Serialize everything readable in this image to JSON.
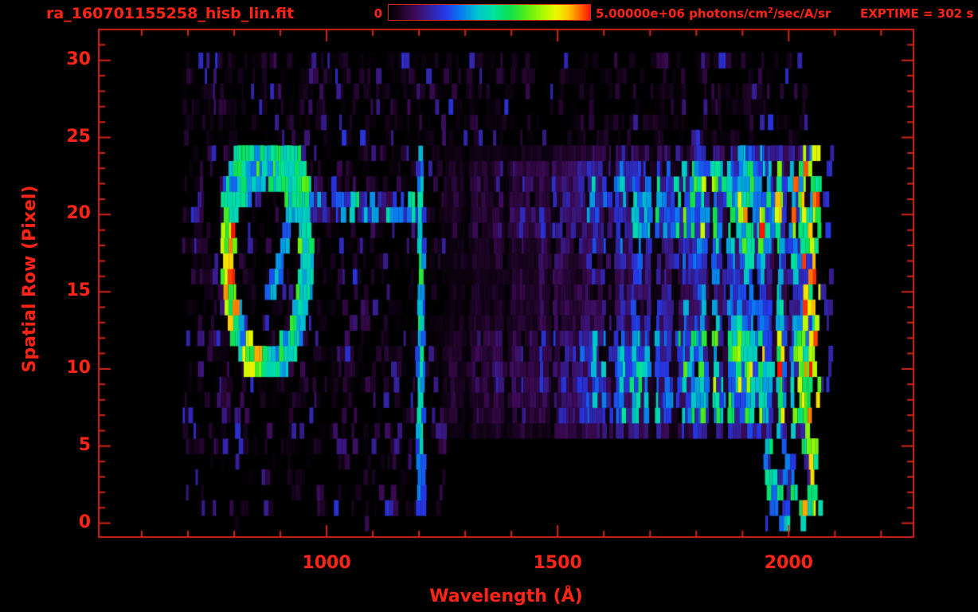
{
  "header": {
    "title": "ra_160701155258_hisb_lin.fit",
    "colorbar_min": "0",
    "colorbar_max": "5.00000e+06",
    "units_prefix": " photons/cm",
    "units_sup": "2",
    "units_suffix": "/sec/A/sr",
    "exptime": "EXPTIME = 302 s"
  },
  "chart_data": {
    "type": "heatmap",
    "title": "ra_160701155258_hisb_lin.fit",
    "xlabel": "Wavelength (Å)",
    "ylabel": "Spatial Row (Pixel)",
    "xlim": [
      507,
      2270
    ],
    "ylim": [
      -0.9,
      32.0
    ],
    "x_major_ticks": [
      1000,
      1500,
      2000
    ],
    "x_minor_step": 100,
    "y_major_ticks": [
      0,
      5,
      10,
      15,
      20,
      25,
      30
    ],
    "y_minor_step": 1,
    "grid": false,
    "legend": "none",
    "text_color": "#ff2416",
    "frame_color": "#d42416",
    "colorbar": {
      "min": 0,
      "max": 5000000,
      "max_label": "5.00000e+06",
      "units": "photons/cm^2/sec/A/sr",
      "exptime_label": "EXPTIME = 302 s",
      "position": "top"
    },
    "colormap_stops": [
      {
        "t": 0.0,
        "color": "#000000"
      },
      {
        "t": 0.06,
        "color": "#1c0424"
      },
      {
        "t": 0.13,
        "color": "#3c0a55"
      },
      {
        "t": 0.2,
        "color": "#35209b"
      },
      {
        "t": 0.28,
        "color": "#2438e8"
      },
      {
        "t": 0.36,
        "color": "#0a7cf0"
      },
      {
        "t": 0.44,
        "color": "#00c4cf"
      },
      {
        "t": 0.52,
        "color": "#00e2a0"
      },
      {
        "t": 0.6,
        "color": "#0ee04e"
      },
      {
        "t": 0.68,
        "color": "#52ee18"
      },
      {
        "t": 0.76,
        "color": "#a4fa00"
      },
      {
        "t": 0.83,
        "color": "#eaf800"
      },
      {
        "t": 0.89,
        "color": "#ffc800"
      },
      {
        "t": 0.94,
        "color": "#ff7a00"
      },
      {
        "t": 1.0,
        "color": "#ff1400"
      }
    ],
    "features": {
      "data_extent": {
        "wavelength": [
          685,
          2095
        ],
        "rows": [
          0,
          30
        ]
      },
      "background_noise": {
        "rows": [
          1,
          24
        ],
        "wavelength": [
          690,
          1258
        ],
        "density": 0.55,
        "max_frac": 0.16
      },
      "top_noise": {
        "rows": [
          25,
          30
        ],
        "wavelength": [
          690,
          2045
        ],
        "density": 0.55,
        "max_frac": 0.14
      },
      "ring": {
        "center_wavelength": 872,
        "center_row": 17.2,
        "rx": 85,
        "ry": 6.9,
        "body_frac": 0.5,
        "hot_left": {
          "wavelength_max": 808,
          "rows": [
            12.5,
            19.5
          ],
          "frac": 0.85
        },
        "hot_bottom": {
          "wavelength": [
            820,
            868
          ],
          "row_max": 12.3,
          "frac": 0.75
        }
      },
      "inner_chord": {
        "from": [
          935,
          22.0
        ],
        "to": [
          878,
          14.3
        ],
        "frac": 0.4
      },
      "tail": {
        "rows": [
          19.4,
          21.6
        ],
        "wavelength": [
          935,
          1192
        ],
        "peak_frac": 0.42
      },
      "emission_line": {
        "center_wavelength": 1204,
        "half_width": 8,
        "rows": [
          1,
          24
        ],
        "peak_frac": 0.55
      },
      "continuum": {
        "wavelength": [
          1255,
          2050
        ],
        "rows": [
          6,
          24
        ],
        "base_frac": 0.06,
        "peak_frac": 0.54,
        "ramp_wavelength_span": 650,
        "row_profile": {
          "6": 0.5,
          "7": 0.95,
          "8": 1.0,
          "9": 1.05,
          "10": 1.05,
          "11": 1.1,
          "12": 1.0,
          "13": 0.65,
          "14": 0.6,
          "15": 0.55,
          "16": 0.55,
          "17": 0.6,
          "18": 0.7,
          "19": 1.0,
          "20": 1.05,
          "21": 1.0,
          "22": 1.05,
          "23": 0.95,
          "24": 0.45
        }
      },
      "lower_right_patch": {
        "rows": [
          0,
          5
        ],
        "wavelength": [
          1950,
          2058
        ],
        "frac": 0.45
      },
      "hot_edge": {
        "wavelength": [
          2030,
          2072
        ],
        "rows": [
          1,
          24
        ],
        "density": 0.55,
        "frac": [
          0.5,
          1.0
        ]
      }
    }
  }
}
